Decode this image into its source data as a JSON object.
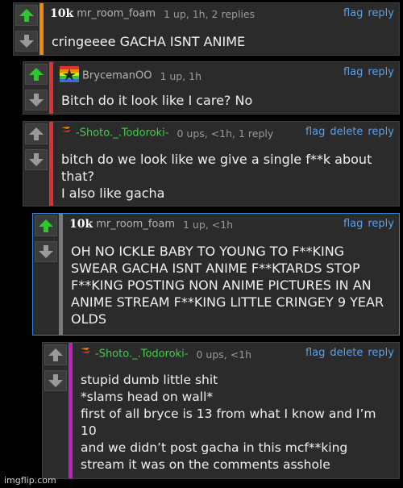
{
  "comments": [
    {
      "username": "mr_room_foam",
      "badge": "10k",
      "meta": "1 up, 1h, 2 replies",
      "links": [
        "flag",
        "reply"
      ],
      "text": "cringeeee GACHA ISNT ANIME",
      "bar_color": "#f08a00"
    },
    {
      "username": "BrycemanOO",
      "avatar_icon": "bryceman-flag-avatar",
      "meta": "1 up, 1h",
      "links": [
        "flag",
        "reply"
      ],
      "text": "Bitch do it look like I care? No",
      "bar_color": "#e03030"
    },
    {
      "username": "-Shoto._.Todoroki-",
      "avatar_icon": "flame-avatar",
      "meta": "0 ups, <1h, 1 reply",
      "links": [
        "flag",
        "delete",
        "reply"
      ],
      "text": "bitch do we look like we give a single f**k about that?\nI also like gacha",
      "bar_color": "#e03030"
    },
    {
      "username": "mr_room_foam",
      "badge": "10k",
      "meta": "1 up, <1h",
      "links": [
        "flag",
        "reply"
      ],
      "text": "OH NO ICKLE BABY TO YOUNG TO F**KING SWEAR GACHA ISNT ANIME F**KTARDS STOP F**KING POSTING NON ANIME PICTURES IN AN ANIME STREAM F**KING LITTLE CRINGEY 9 YEAR OLDS",
      "bar_color": "#7a7a7a"
    },
    {
      "username": "-Shoto._.Todoroki-",
      "avatar_icon": "flame-avatar",
      "meta": "0 ups, <1h",
      "links": [
        "flag",
        "delete",
        "reply"
      ],
      "text": "stupid dumb little shit\n*slams head on wall*\nfirst of all bryce is 13 from what I know and I’m 10\nand we didn’t post gacha in this mcf**king stream it was on the comments asshole",
      "bar_color": "#c020c0"
    }
  ],
  "colors": {
    "upvote_active": "#2ec82e",
    "upvote_inactive": "#9a9a9a",
    "downvote": "#9a9a9a",
    "link": "#5aa0e6",
    "username_green": "#3fd24a",
    "highlight_border": "#3a84c9"
  },
  "watermark": "imgflip.com"
}
